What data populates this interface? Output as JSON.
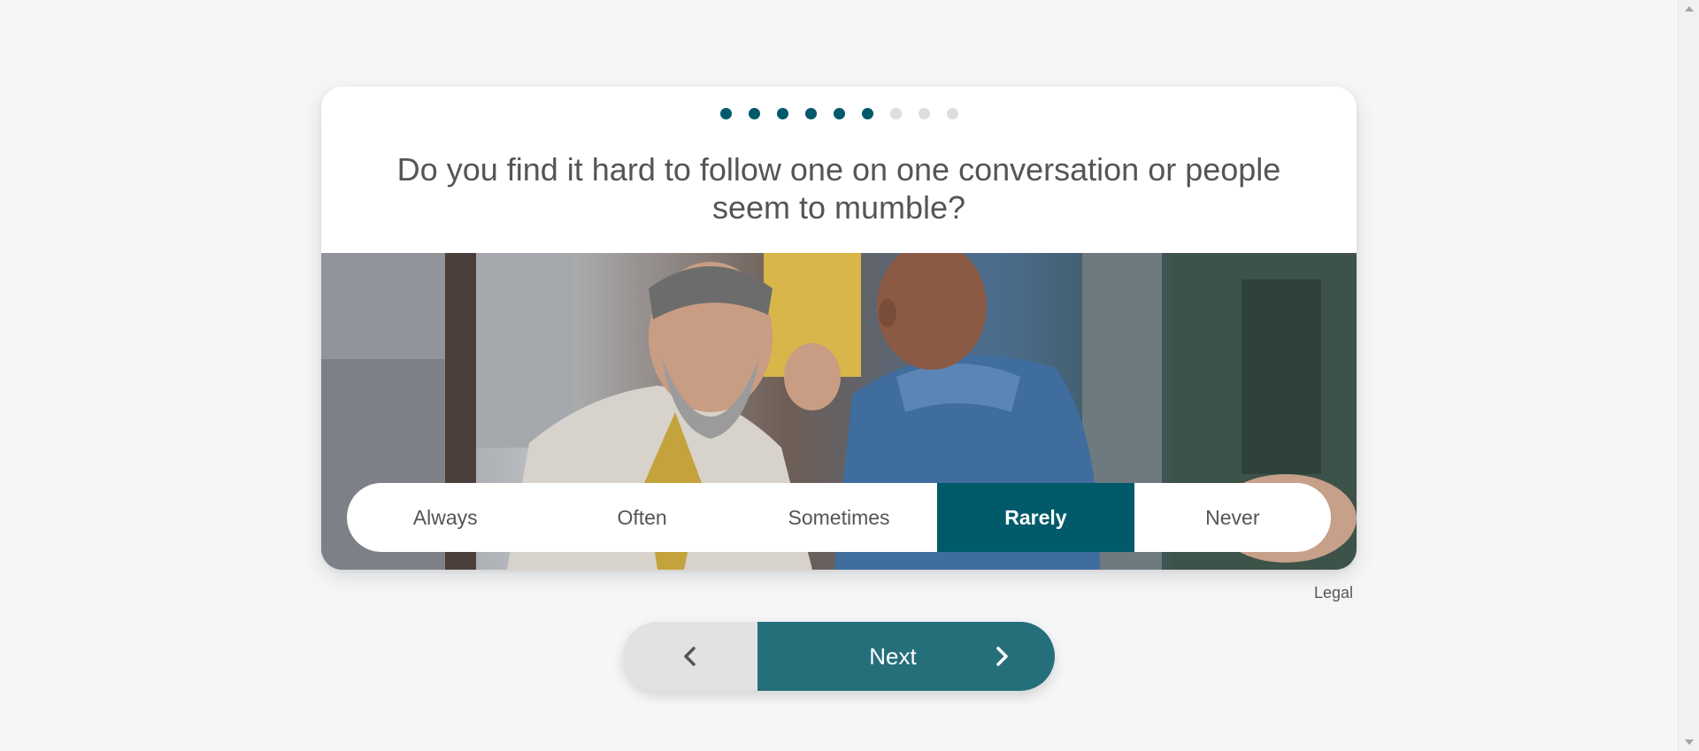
{
  "progress": {
    "completed": 6,
    "total": 9,
    "colors": {
      "done": "#005a6a",
      "todo": "#dedede"
    }
  },
  "question": {
    "text": "Do you find it hard to follow one on one conversation or people seem to mumble?"
  },
  "image": {
    "description_icon": "photo-two-people-talking-cafe"
  },
  "answers": {
    "options": [
      "Always",
      "Often",
      "Sometimes",
      "Rarely",
      "Never"
    ],
    "selected": "Rarely",
    "accent": "#005a6a"
  },
  "footer": {
    "legal_label": "Legal"
  },
  "nav": {
    "back_icon": "chevron-left-icon",
    "next_label": "Next",
    "next_icon": "chevron-right-icon",
    "next_color": "#256f7b"
  }
}
